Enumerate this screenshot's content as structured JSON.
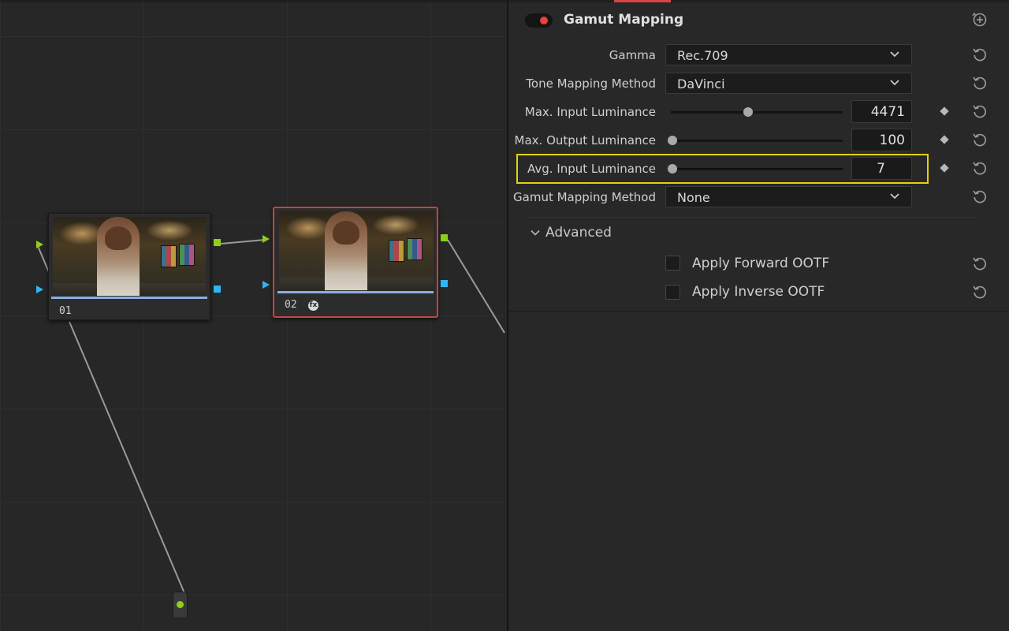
{
  "graph": {
    "nodes": [
      {
        "label": "01",
        "selected": false
      },
      {
        "label": "02",
        "selected": true,
        "icon": "fx-icon"
      }
    ]
  },
  "panel": {
    "effect_title": "Gamut Mapping",
    "enabled": true,
    "rows": {
      "gamma": {
        "label": "Gamma",
        "value": "Rec.709"
      },
      "tone_mapping": {
        "label": "Tone Mapping Method",
        "value": "DaVinci"
      },
      "max_input": {
        "label": "Max. Input Luminance",
        "value": "4471",
        "slider_fraction": 0.45
      },
      "max_output": {
        "label": "Max. Output Luminance",
        "value": "100",
        "slider_fraction": 0.0
      },
      "avg_input": {
        "label": "Avg. Input Luminance",
        "value": "7",
        "slider_fraction": 0.0
      },
      "gamut_method": {
        "label": "Gamut Mapping Method",
        "value": "None"
      }
    },
    "advanced": {
      "label": "Advanced",
      "expanded": true,
      "options": [
        {
          "label": "Apply Forward OOTF",
          "checked": false
        },
        {
          "label": "Apply Inverse OOTF",
          "checked": false
        }
      ]
    }
  },
  "colors": {
    "accent_red": "#e8423b",
    "highlight_yellow": "#e2d30e",
    "port_green": "#8fce1a",
    "port_blue": "#2fb5f0",
    "selected_node_border": "#c8443e"
  }
}
